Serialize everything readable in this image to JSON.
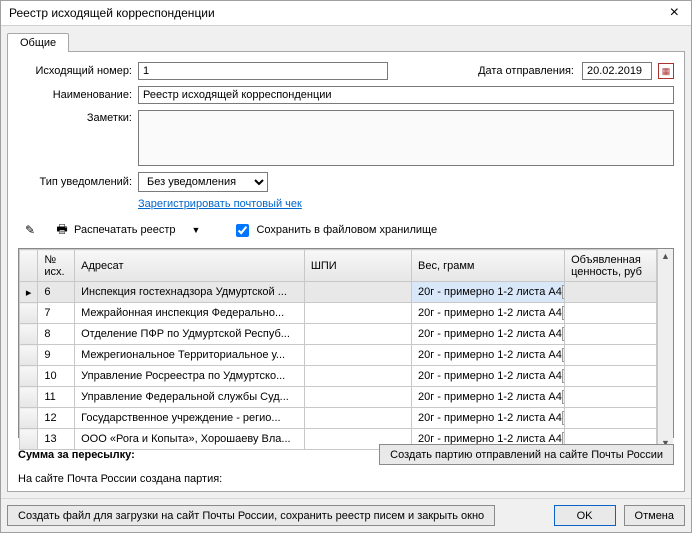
{
  "window": {
    "title": "Реестр исходящей корреспонденции"
  },
  "tabs": {
    "general": "Общие"
  },
  "form": {
    "outgoing_number_label": "Исходящий номер:",
    "outgoing_number_value": "1",
    "send_date_label": "Дата отправления:",
    "send_date_value": "20.02.2019",
    "name_label": "Наименование:",
    "name_value": "Реестр исходящей корреспонденции",
    "notes_label": "Заметки:",
    "notes_value": "",
    "notif_type_label": "Тип уведомлений:",
    "notif_type_value": "Без уведомления",
    "register_check_link": "Зарегистрировать почтовый чек"
  },
  "toolbar": {
    "print_label": "Распечатать реестр",
    "save_file_store_label": "Сохранить в файловом хранилище",
    "save_file_store_checked": true
  },
  "grid": {
    "headers": {
      "num": "№ исх.",
      "addressee": "Адресат",
      "shpi": "ШПИ",
      "weight": "Вес, грамм",
      "value": "Объявленная ценность, руб"
    },
    "rows": [
      {
        "selected": true,
        "num": "6",
        "addressee": "Инспекция гостехнадзора Удмуртской ...",
        "shpi": "",
        "weight": "20г - примерно 1-2 листа А4",
        "value": ""
      },
      {
        "selected": false,
        "num": "7",
        "addressee": "Межрайонная инспекция Федерально...",
        "shpi": "",
        "weight": "20г - примерно 1-2 листа А4",
        "value": ""
      },
      {
        "selected": false,
        "num": "8",
        "addressee": "Отделение ПФР по Удмуртской Респуб...",
        "shpi": "",
        "weight": "20г - примерно 1-2 листа А4",
        "value": ""
      },
      {
        "selected": false,
        "num": "9",
        "addressee": "Межрегиональное Территориальное у...",
        "shpi": "",
        "weight": "20г - примерно 1-2 листа А4",
        "value": ""
      },
      {
        "selected": false,
        "num": "10",
        "addressee": "Управление Росреестра по Удмуртско...",
        "shpi": "",
        "weight": "20г - примерно 1-2 листа А4",
        "value": ""
      },
      {
        "selected": false,
        "num": "11",
        "addressee": "Управление Федеральной службы Суд...",
        "shpi": "",
        "weight": "20г - примерно 1-2 листа А4",
        "value": ""
      },
      {
        "selected": false,
        "num": "12",
        "addressee": "Государственное учреждение - регио...",
        "shpi": "",
        "weight": "20г - примерно 1-2 листа А4",
        "value": ""
      },
      {
        "selected": false,
        "num": "13",
        "addressee": "ООО «Рога и Копыта», Хорошаеву Вла...",
        "shpi": "",
        "weight": "20г - примерно 1-2 листа А4",
        "value": ""
      }
    ]
  },
  "bottom": {
    "sum_label": "Сумма за пересылку:",
    "create_batch_btn": "Создать партию отправлений на сайте Почты России",
    "batch_created_label": "На сайте Почта России создана партия:"
  },
  "footer": {
    "create_file_btn": "Создать файл для загрузки на сайт Почты России, сохранить реестр писем и закрыть окно",
    "ok": "OK",
    "cancel": "Отмена"
  }
}
